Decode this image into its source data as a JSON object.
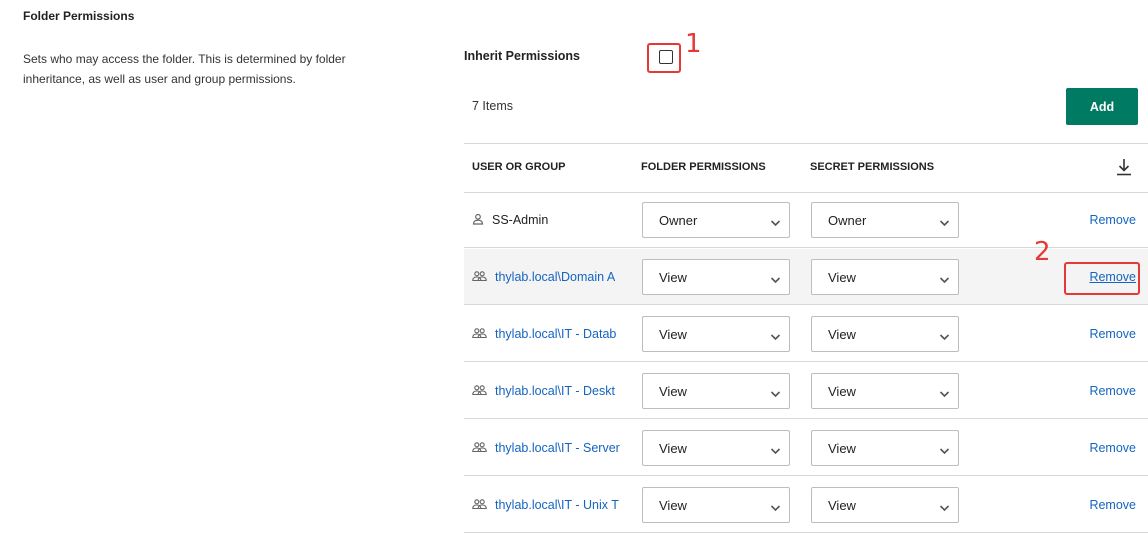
{
  "section": {
    "title": "Folder Permissions",
    "description": "Sets who may access the folder. This is determined by folder inheritance, as well as user and group permissions."
  },
  "inherit": {
    "label": "Inherit Permissions",
    "checked": false
  },
  "annotations": {
    "one": "1",
    "two": "2"
  },
  "items_count": "7 Items",
  "add_label": "Add",
  "table": {
    "headers": {
      "user": "USER OR GROUP",
      "folder": "FOLDER PERMISSIONS",
      "secret": "SECRET PERMISSIONS",
      "download_icon": "download-icon"
    },
    "rows": [
      {
        "icon": "user-icon",
        "name": "SS-Admin",
        "is_link": false,
        "folder": "Owner",
        "secret": "Owner",
        "action": "Remove"
      },
      {
        "icon": "group-icon",
        "name": "thylab.local\\Domain A",
        "is_link": true,
        "folder": "View",
        "secret": "View",
        "action": "Remove"
      },
      {
        "icon": "group-icon",
        "name": "thylab.local\\IT - Datab",
        "is_link": true,
        "folder": "View",
        "secret": "View",
        "action": "Remove"
      },
      {
        "icon": "group-icon",
        "name": "thylab.local\\IT - Deskt",
        "is_link": true,
        "folder": "View",
        "secret": "View",
        "action": "Remove"
      },
      {
        "icon": "group-icon",
        "name": "thylab.local\\IT - Server",
        "is_link": true,
        "folder": "View",
        "secret": "View",
        "action": "Remove"
      },
      {
        "icon": "group-icon",
        "name": "thylab.local\\IT - Unix T",
        "is_link": true,
        "folder": "View",
        "secret": "View",
        "action": "Remove"
      }
    ]
  },
  "colors": {
    "accent": "#007a63",
    "link": "#1565c0",
    "annotation": "#e53935"
  }
}
